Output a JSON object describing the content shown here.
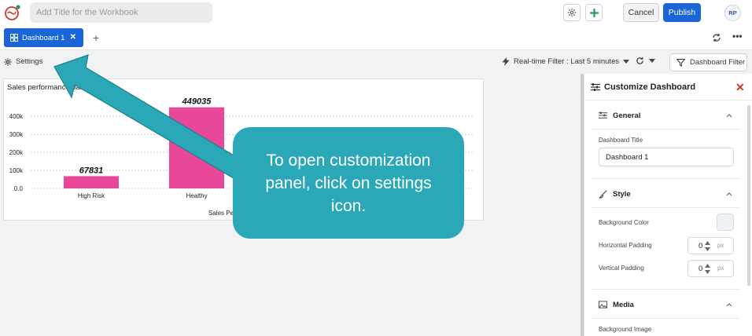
{
  "header": {
    "title_placeholder": "Add Title for the Workbook",
    "cancel_label": "Cancel",
    "publish_label": "Publish",
    "avatar_initials": "RP",
    "add_icon": "plus-icon",
    "settings_icon": "gear-icon"
  },
  "tabs": {
    "items": [
      {
        "label": "Dashboard 1",
        "active": true
      }
    ],
    "add_icon": "plus-icon",
    "refresh_icon": "refresh-icon",
    "more_icon": "more-icon"
  },
  "toolbar": {
    "settings_label": "Settings",
    "realtime_filter_label": "Real-time Filter : Last 5 minutes",
    "dashboard_filter_label": "Dashboard Filter"
  },
  "widget": {
    "title": "Sales performance band",
    "xlabel_visible": "Sales Pe"
  },
  "chart_data": {
    "type": "bar",
    "categories": [
      "High Risk",
      "Healthy"
    ],
    "values": [
      67831,
      449035
    ],
    "data_labels": [
      "67831",
      "449035"
    ],
    "yticks": [
      "0.0",
      "100k",
      "200k",
      "300k",
      "400k"
    ],
    "ylim": [
      0,
      450000
    ],
    "grid": true,
    "bar_color": "#e8479a"
  },
  "panel": {
    "title": "Customize Dashboard",
    "close_icon": "close-icon",
    "sections": {
      "general": {
        "label": "General",
        "dashboard_title_label": "Dashboard Title",
        "dashboard_title_value": "Dashboard 1"
      },
      "style": {
        "label": "Style",
        "background_color_label": "Background Color",
        "horizontal_padding_label": "Horizontal Padding",
        "horizontal_padding_value": "0",
        "vertical_padding_label": "Vertical Padding",
        "vertical_padding_value": "0",
        "unit": "px"
      },
      "media": {
        "label": "Media",
        "background_image_label": "Background Image"
      }
    }
  },
  "callout": {
    "text": "To open customization panel, click on settings icon.",
    "color": "#2ba8b7"
  },
  "colors": {
    "accent": "#1a66d8",
    "close": "#d9342b",
    "add_green": "#1e9a5b"
  }
}
